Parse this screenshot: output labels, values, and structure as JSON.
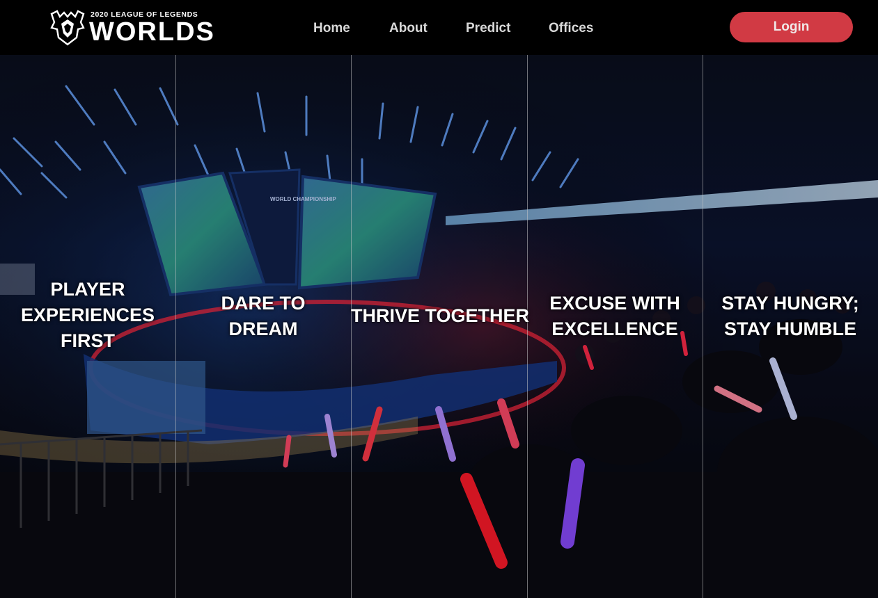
{
  "brand": {
    "small_text": "2020 LEAGUE OF LEGENDS",
    "big_text": "WORLDS"
  },
  "nav": {
    "items": [
      {
        "label": "Home"
      },
      {
        "label": "About"
      },
      {
        "label": "Predict"
      },
      {
        "label": "Offices"
      }
    ],
    "login_label": "Login"
  },
  "hero": {
    "values": [
      {
        "text": "PLAYER EXPERIENCES FIRST"
      },
      {
        "text": "DARE TO DREAM"
      },
      {
        "text": "THRIVE TOGETHER"
      },
      {
        "text": "EXCUSE WITH EXCELLENCE"
      },
      {
        "text": "STAY HUNGRY; STAY HUMBLE"
      }
    ],
    "arena_screen_text": "WORLD CHAMPIONSHIP"
  },
  "colors": {
    "login_bg": "#d13a44",
    "nav_bg": "#000000",
    "nav_text": "#d9d9d9"
  }
}
